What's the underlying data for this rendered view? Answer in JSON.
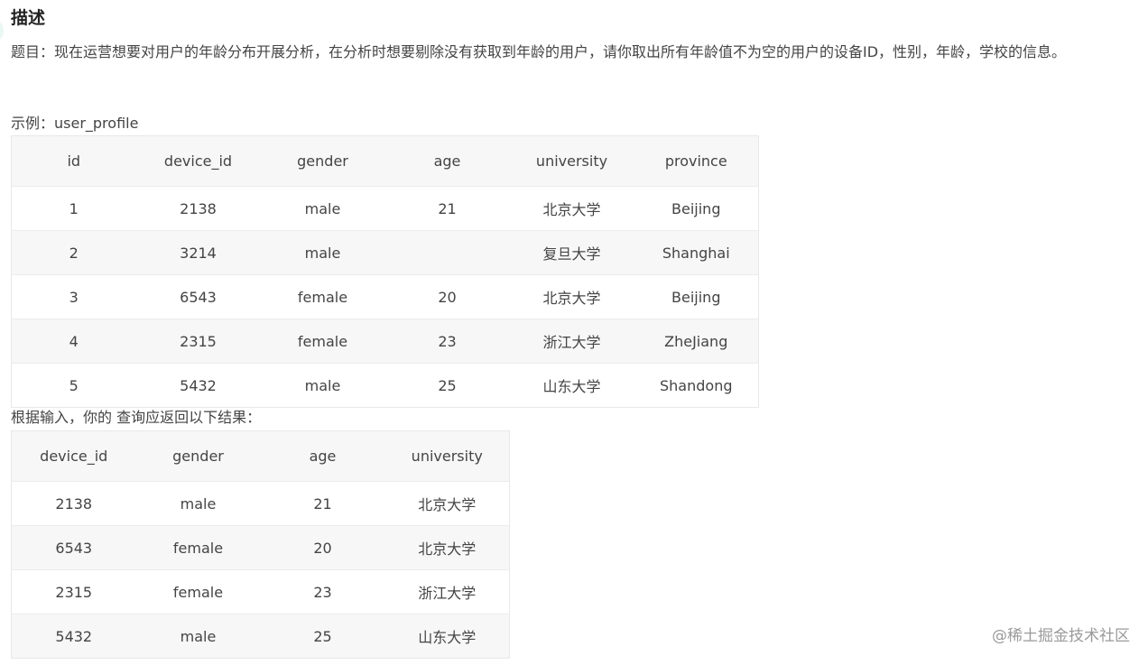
{
  "heading": "描述",
  "description": "题目：现在运营想要对用户的年龄分布开展分析，在分析时想要剔除没有获取到年龄的用户，请你取出所有年龄值不为空的用户的设备ID，性别，年龄，学校的信息。",
  "example_label": "示例：user_profile",
  "example_table": {
    "columns": [
      "id",
      "device_id",
      "gender",
      "age",
      "university",
      "province"
    ],
    "rows": [
      [
        "1",
        "2138",
        "male",
        "21",
        "北京大学",
        "Beijing"
      ],
      [
        "2",
        "3214",
        "male",
        "",
        "复旦大学",
        "Shanghai"
      ],
      [
        "3",
        "6543",
        "female",
        "20",
        "北京大学",
        "Beijing"
      ],
      [
        "4",
        "2315",
        "female",
        "23",
        "浙江大学",
        "ZheJiang"
      ],
      [
        "5",
        "5432",
        "male",
        "25",
        "山东大学",
        "Shandong"
      ]
    ]
  },
  "result_label": "根据输入，你的 查询应返回以下结果：",
  "result_table": {
    "columns": [
      "device_id",
      "gender",
      "age",
      "university"
    ],
    "rows": [
      [
        "2138",
        "male",
        "21",
        "北京大学"
      ],
      [
        "6543",
        "female",
        "20",
        "北京大学"
      ],
      [
        "2315",
        "female",
        "23",
        "浙江大学"
      ],
      [
        "5432",
        "male",
        "25",
        "山东大学"
      ]
    ]
  },
  "watermark": "@稀土掘金技术社区",
  "colors": {
    "text": "#444444",
    "header_bg": "#f7f7f7",
    "border": "#e8e8e8",
    "watermark": "#9a9a9a"
  }
}
